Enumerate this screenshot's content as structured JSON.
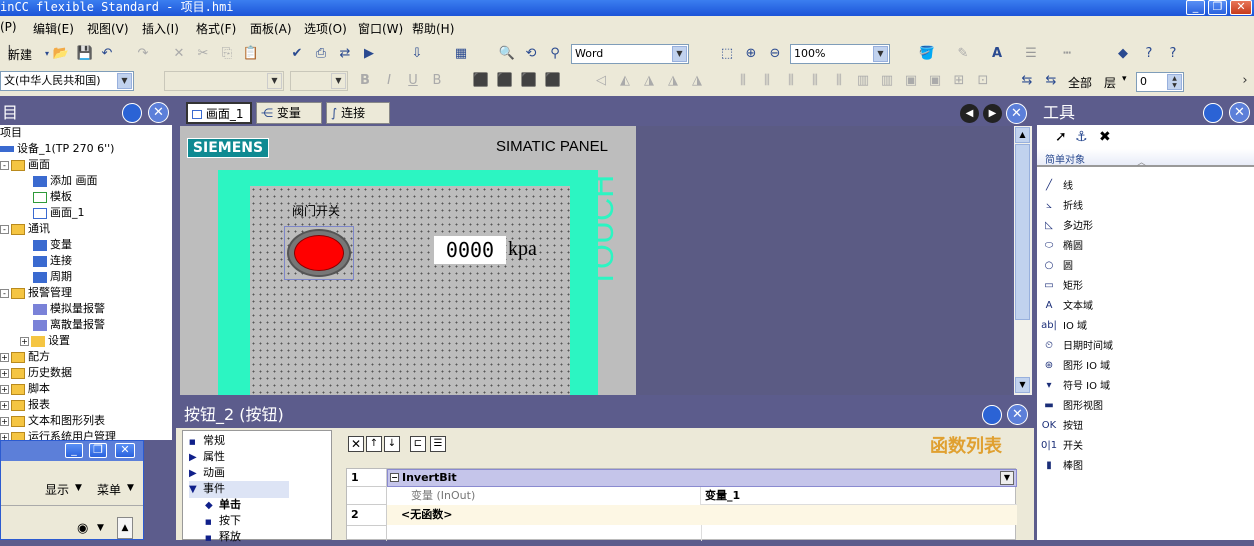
{
  "title": "inCC flexible Standard - 项目.hmi",
  "menu": [
    "(P)",
    "编辑(E)",
    "视图(V)",
    "插入(I)",
    "格式(F)",
    "面板(A)",
    "选项(O)",
    "窗口(W)",
    "帮助(H)"
  ],
  "toolbar": {
    "new_label": "新建",
    "font_value": "Word",
    "zoom_value": "100%",
    "lang_value": "文(中华人民共和国)",
    "all_label": "全部",
    "layer_label": "层",
    "layer_value": "0"
  },
  "project_pane": {
    "title": "目",
    "root": "项目",
    "device": "设备_1(TP 270 6'')",
    "items": [
      {
        "label": "画面",
        "indent": 1,
        "icon": "folder-icon",
        "expander": "-"
      },
      {
        "label": "添加 画面",
        "indent": 2,
        "icon": "add-screen-icon",
        "expander": ""
      },
      {
        "label": "模板",
        "indent": 2,
        "icon": "template-icon",
        "expander": ""
      },
      {
        "label": "画面_1",
        "indent": 2,
        "icon": "screen-icon",
        "expander": ""
      },
      {
        "label": "通讯",
        "indent": 1,
        "icon": "folder-icon",
        "expander": "-"
      },
      {
        "label": "变量",
        "indent": 2,
        "icon": "tags-icon",
        "expander": ""
      },
      {
        "label": "连接",
        "indent": 2,
        "icon": "connection-icon",
        "expander": ""
      },
      {
        "label": "周期",
        "indent": 2,
        "icon": "cycle-icon",
        "expander": ""
      },
      {
        "label": "报警管理",
        "indent": 1,
        "icon": "folder-icon",
        "expander": "-"
      },
      {
        "label": "模拟量报警",
        "indent": 2,
        "icon": "alarm-icon",
        "expander": ""
      },
      {
        "label": "离散量报警",
        "indent": 2,
        "icon": "alarm-icon",
        "expander": ""
      },
      {
        "label": "设置",
        "indent": 2,
        "icon": "settings-icon",
        "expander": "+"
      },
      {
        "label": "配方",
        "indent": 1,
        "icon": "folder-icon",
        "expander": "+"
      },
      {
        "label": "历史数据",
        "indent": 1,
        "icon": "folder-icon",
        "expander": "+"
      },
      {
        "label": "脚本",
        "indent": 1,
        "icon": "folder-icon",
        "expander": "+"
      },
      {
        "label": "报表",
        "indent": 1,
        "icon": "folder-icon",
        "expander": "+"
      },
      {
        "label": "文本和图形列表",
        "indent": 1,
        "icon": "folder-icon",
        "expander": "+"
      },
      {
        "label": "运行系统用户管理",
        "indent": 1,
        "icon": "folder-icon",
        "expander": "+"
      }
    ]
  },
  "editor_tabs": [
    "画面_1",
    "变量",
    "连接"
  ],
  "screen": {
    "brand": "SIEMENS",
    "panel_label": "SIMATIC PANEL",
    "touch_label": "TOUCH",
    "valve_label": "阀门开关",
    "io_value": "0000",
    "unit": "kpa"
  },
  "properties": {
    "title": "按钮_2 (按钮)",
    "nav": [
      {
        "label": "常规",
        "marker": "square"
      },
      {
        "label": "属性",
        "marker": "arrow"
      },
      {
        "label": "动画",
        "marker": "arrow"
      },
      {
        "label": "事件",
        "marker": "open"
      },
      {
        "label": "单击",
        "marker": "diamond"
      },
      {
        "label": "按下",
        "marker": "square"
      },
      {
        "label": "释放",
        "marker": "square"
      }
    ],
    "function_list_title": "函数列表",
    "rows": [
      {
        "num": "1",
        "func": "InvertBit"
      },
      {
        "param": "变量 (InOut)",
        "value": "变量_1"
      },
      {
        "num": "2",
        "func": "<无函数>"
      }
    ]
  },
  "tools_pane": {
    "title": "工具",
    "group": "简单对象",
    "items": [
      {
        "label": "线",
        "icon": "line-icon"
      },
      {
        "label": "折线",
        "icon": "polyline-icon"
      },
      {
        "label": "多边形",
        "icon": "polygon-icon"
      },
      {
        "label": "椭圆",
        "icon": "ellipse-icon"
      },
      {
        "label": "圆",
        "icon": "circle-icon"
      },
      {
        "label": "矩形",
        "icon": "rectangle-icon"
      },
      {
        "label": "文本域",
        "icon": "text-field-icon"
      },
      {
        "label": "IO 域",
        "icon": "io-field-icon"
      },
      {
        "label": "日期时间域",
        "icon": "datetime-icon"
      },
      {
        "label": "图形 IO 域",
        "icon": "graphic-io-icon"
      },
      {
        "label": "符号 IO 域",
        "icon": "symbolic-io-icon"
      },
      {
        "label": "图形视图",
        "icon": "graphic-view-icon"
      },
      {
        "label": "按钮",
        "icon": "button-icon"
      },
      {
        "label": "开关",
        "icon": "switch-icon"
      },
      {
        "label": "棒图",
        "icon": "bar-icon"
      }
    ]
  },
  "float_window": {
    "display_label": "显示",
    "menu_label": "菜单"
  }
}
